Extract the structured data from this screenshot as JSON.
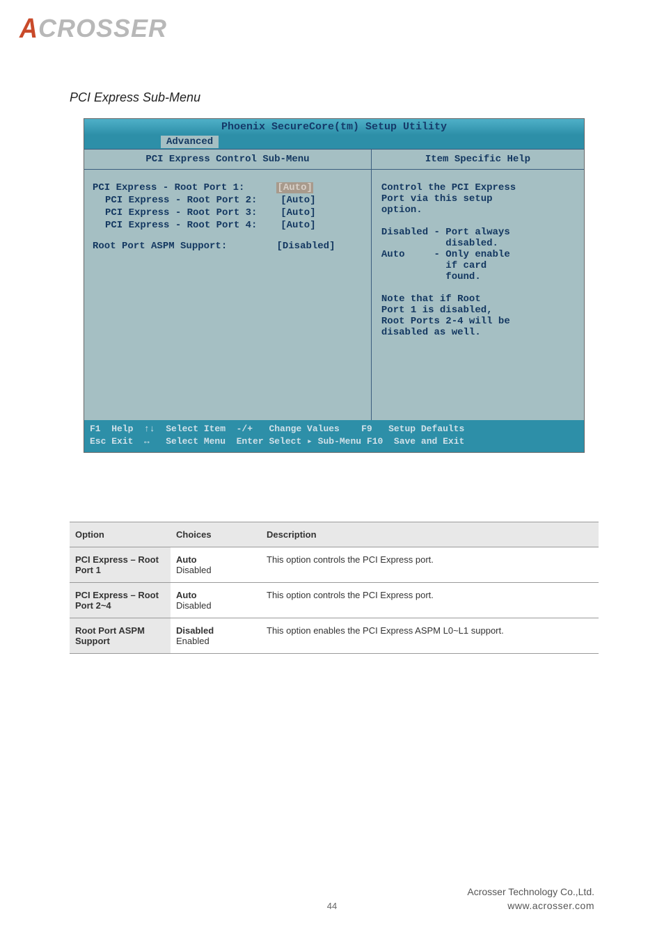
{
  "logo": {
    "first": "A",
    "rest": "CROSSER"
  },
  "section_title": "PCI Express Sub-Menu",
  "bios": {
    "title": "Phoenix SecureCore(tm) Setup Utility",
    "tab": "Advanced",
    "left_header": "PCI Express Control Sub-Menu",
    "right_header": "Item Specific Help",
    "rows": [
      {
        "label": "PCI Express - Root Port 1:",
        "value": "[Auto]",
        "selected": true,
        "indent": false
      },
      {
        "label": "PCI Express - Root Port 2:",
        "value": "[Auto]",
        "selected": false,
        "indent": true
      },
      {
        "label": "PCI Express - Root Port 3:",
        "value": "[Auto]",
        "selected": false,
        "indent": true
      },
      {
        "label": "PCI Express - Root Port 4:",
        "value": "[Auto]",
        "selected": false,
        "indent": true
      }
    ],
    "row_aspm": {
      "label": "Root Port ASPM Support:",
      "value": "[Disabled]"
    },
    "help_lines": [
      "Control the PCI Express",
      "Port via this setup",
      "option.",
      "",
      "Disabled - Port always",
      "           disabled.",
      "Auto     - Only enable",
      "           if card",
      "           found.",
      "",
      "Note that if Root",
      "Port 1 is disabled,",
      "Root Ports 2-4 will be",
      "disabled as well."
    ],
    "footer": {
      "l1": "F1  Help  ↑↓  Select Item  -/+   Change Values    F9   Setup Defaults",
      "l2": "Esc Exit  ↔   Select Menu  Enter Select ▸ Sub-Menu F10  Save and Exit"
    }
  },
  "table": {
    "headers": [
      "Option",
      "Choices",
      "Description"
    ],
    "rows": [
      {
        "c1": "PCI Express – Root Port 1",
        "c2a": "Auto",
        "c2b": "Disabled",
        "c3": "This option controls the PCI Express port."
      },
      {
        "c1": "PCI Express – Root Port 2~4",
        "c2a": "Auto",
        "c2b": "Disabled",
        "c3": "This option controls the PCI Express port."
      },
      {
        "c1": "Root Port ASPM Support",
        "c2a": "Disabled",
        "c2b": "Enabled",
        "c3": "This option enables the PCI Express ASPM L0~L1 support."
      }
    ]
  },
  "footer": {
    "company": "Acrosser Technology Co.,Ltd.",
    "url": "www.acrosser.com"
  },
  "page": "44"
}
